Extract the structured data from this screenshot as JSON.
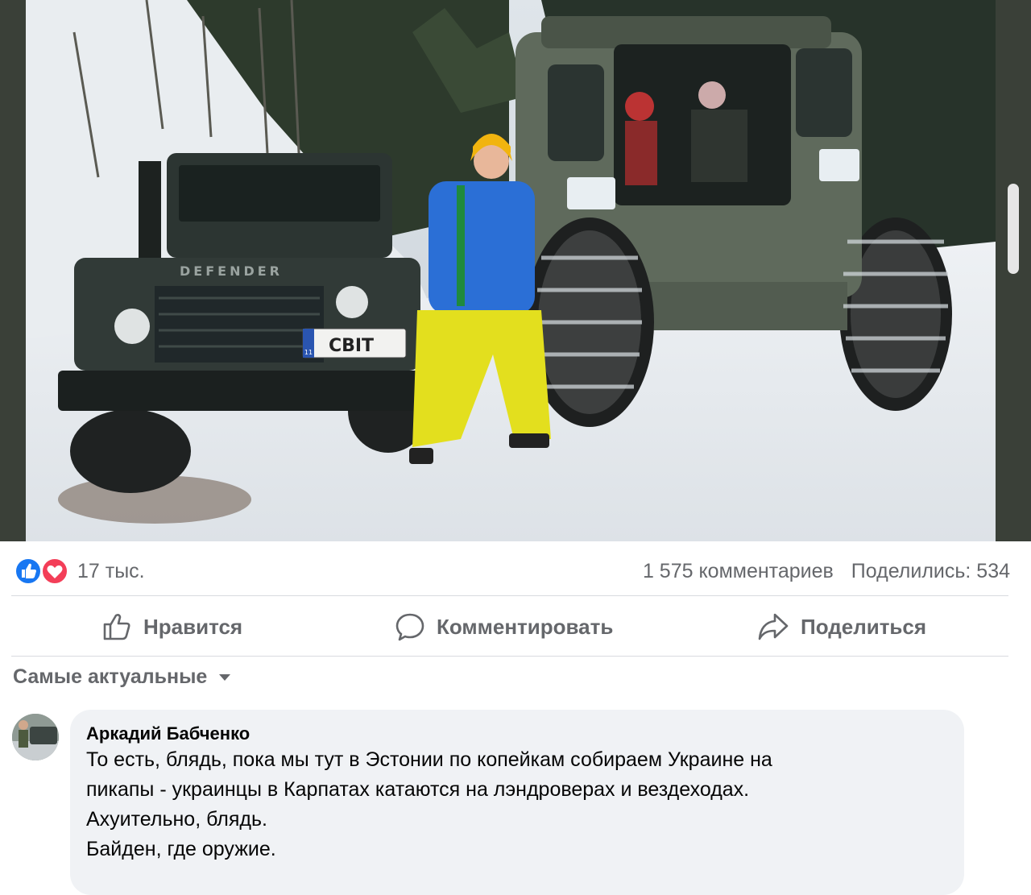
{
  "post": {
    "photo": {
      "alt": "",
      "plate_text": "СВІТ",
      "plate_region": "11",
      "vehicle_badge": "DEFENDER"
    },
    "reactions": {
      "icons": [
        "like-icon",
        "love-icon"
      ],
      "count": "17 тыс.",
      "comments": "1 575 комментариев",
      "shares": "Поделились: 534"
    },
    "actions": {
      "like": "Нравится",
      "comment": "Комментировать",
      "share": "Поделиться"
    },
    "sort": {
      "label": "Самые актуальные",
      "icon": "caret-down-icon"
    },
    "comments": [
      {
        "author": "Аркадий Бабченко",
        "lines": [
          "То есть, блядь, пока мы тут в Эстонии по копейкам собираем Украине на",
          "пикапы - украинцы в Карпатах катаются на лэндроверах и вездеходах.",
          "Ахуительно, блядь.",
          "Байден, где оружие."
        ]
      }
    ]
  },
  "colors": {
    "secondary_text": "#65676b",
    "like_blue": "#1877f2",
    "love_red": "#f33e58",
    "bubble_bg": "#f0f2f5"
  }
}
